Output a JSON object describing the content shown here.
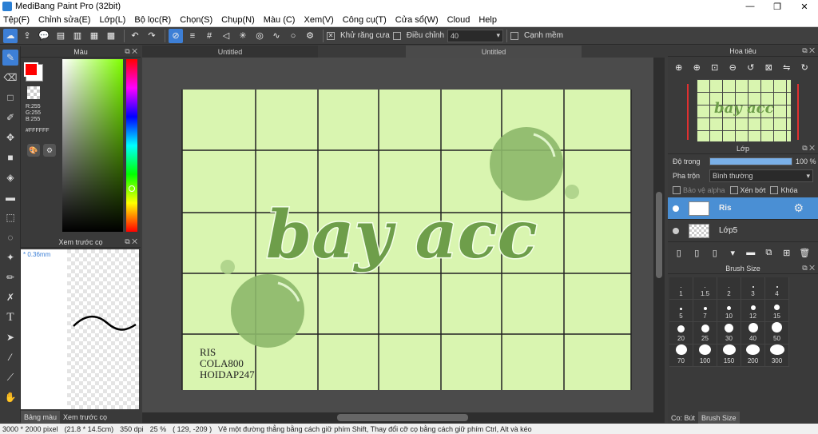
{
  "window": {
    "title": "MediBang Paint Pro (32bit)",
    "min": "—",
    "max": "❐",
    "close": "✕"
  },
  "menu": [
    "Tệp(F)",
    "Chỉnh sửa(E)",
    "Lớp(L)",
    "Bộ lọc(R)",
    "Chọn(S)",
    "Chụp(N)",
    "Màu (C)",
    "Xem(V)",
    "Công cụ(T)",
    "Cửa sổ(W)",
    "Cloud",
    "Help"
  ],
  "toolbar": {
    "antialias_label": "Khử răng cưa",
    "correction_label": "Điều chỉnh",
    "correction_value": "40",
    "edge_label": "Cạnh mềm"
  },
  "color_panel": {
    "title": "Màu",
    "r": "R:255",
    "g": "G:255",
    "b": "B:255",
    "hex": "#FFFFFF",
    "primary_color": "#ff0000"
  },
  "brush_preview": {
    "title": "Xem trước cọ",
    "size": "* 0.36mm"
  },
  "bottom_tabs": [
    "Bảng màu",
    "Xem trước cọ"
  ],
  "doc_tabs": [
    "Untitled",
    "Untitled"
  ],
  "artwork": {
    "title_text": "bay acc",
    "lines": [
      "RIS",
      "COLA800",
      "HOIDAP247"
    ],
    "bg": "#d9f5b0",
    "ink": "#6e9e4a"
  },
  "status": {
    "size": "3000 * 2000 pixel",
    "cm": "(21.8 * 14.5cm)",
    "dpi": "350 dpi",
    "zoom": "25 %",
    "coords": "( 129, -209 )",
    "hint": "Vẽ một đường thẳng bằng cách giữ phím Shift, Thay đổi cỡ cọ bằng cách giữ phím Ctrl, Alt và kéo"
  },
  "navigator": {
    "title": "Hoa tiêu"
  },
  "layers": {
    "title": "Lớp",
    "opacity_label": "Độ trong",
    "opacity_value": "100 %",
    "opacity_fraction": 1.0,
    "blend_label": "Pha trộn",
    "blend_value": "Bình thường",
    "protect_alpha": "Bảo vệ alpha",
    "clipping": "Xén bớt",
    "lock": "Khóa",
    "items": [
      {
        "name": "Ris",
        "active": true
      },
      {
        "name": "Lớp5",
        "active": false
      }
    ]
  },
  "brush_size": {
    "title": "Brush Size",
    "sizes": [
      "1",
      "1.5",
      "2",
      "3",
      "4",
      "5",
      "7",
      "10",
      "12",
      "15",
      "20",
      "25",
      "30",
      "40",
      "50",
      "70",
      "100",
      "150",
      "200",
      "300"
    ]
  },
  "right_bottom_tabs": [
    "Co: Bút",
    "Brush Size"
  ]
}
